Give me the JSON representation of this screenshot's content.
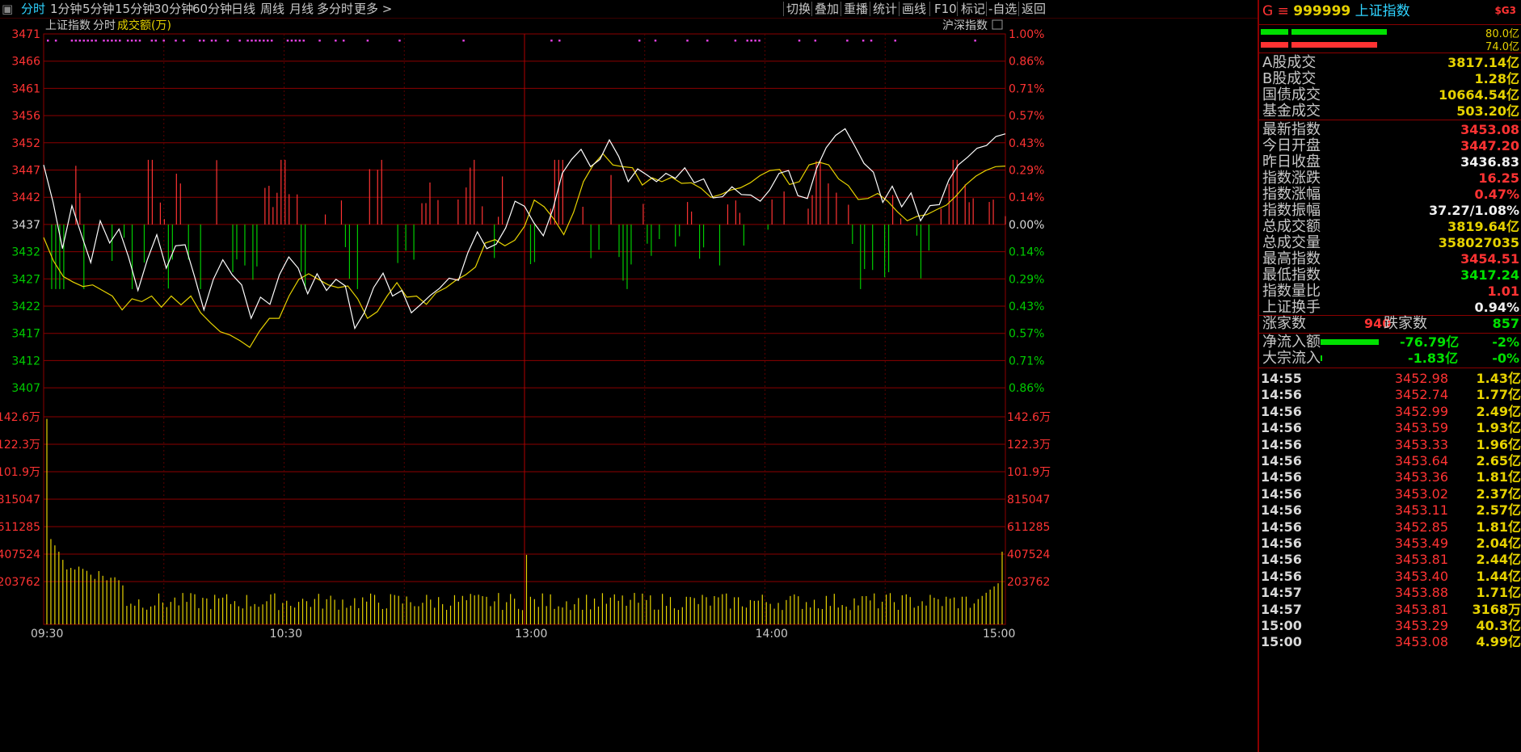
{
  "toolbar": {
    "period_tabs": [
      "分时",
      "1分钟",
      "5分钟",
      "15分钟",
      "30分钟",
      "60分钟",
      "日线",
      "周线",
      "月线",
      "多分时",
      "更多 >"
    ],
    "tools": [
      "切换",
      "叠加",
      "重播",
      "统计",
      "画线",
      "F10",
      "标记",
      "-自选",
      "返回"
    ]
  },
  "chart": {
    "legend_name": "上证指数",
    "legend_mode": "分时",
    "legend_volume": "成交额(万)",
    "overlay_label": "沪深指数",
    "colors": {
      "price": "#ffffff",
      "avg": "#e6d200",
      "up": "#ff3333",
      "down": "#00cc00",
      "grid": "#8b0000",
      "volume": "#e6d200"
    }
  },
  "chart_data": {
    "type": "line",
    "price_ticks_left": [
      "3471",
      "3466",
      "3461",
      "3456",
      "3452",
      "3447",
      "3442",
      "3437",
      "3432",
      "3427",
      "3422",
      "3417",
      "3412",
      "3407"
    ],
    "pct_ticks_right": [
      "1.00%",
      "0.86%",
      "0.71%",
      "0.57%",
      "0.43%",
      "0.29%",
      "0.14%",
      "0.00%",
      "0.14%",
      "0.29%",
      "0.43%",
      "0.57%",
      "0.71%",
      "0.86%"
    ],
    "volume_ticks": [
      "142.6万",
      "122.3万",
      "101.9万",
      "815047",
      "611285",
      "407524",
      "203762"
    ],
    "time_ticks": [
      "09:30",
      "10:30",
      "13:00",
      "14:00",
      "15:00"
    ],
    "prev_close": 3436.83,
    "ylim": [
      3407,
      3471
    ],
    "price_series": [
      3447.5,
      3440.8,
      3432.5,
      3440.2,
      3435,
      3430,
      3437.5,
      3433.5,
      3436,
      3431,
      3425,
      3430.5,
      3435,
      3429,
      3433,
      3433.2,
      3427.5,
      3421.5,
      3427,
      3430.5,
      3427.8,
      3426,
      3420,
      3423.8,
      3422.5,
      3427.8,
      3431,
      3429,
      3424.4,
      3428,
      3425,
      3427,
      3425.8,
      3418.2,
      3421,
      3425.5,
      3428.1,
      3424,
      3425,
      3421,
      3422.5,
      3424.1,
      3425.4,
      3427.2,
      3426.8,
      3431.8,
      3435.5,
      3432.5,
      3433.3,
      3436.2,
      3441,
      3440.1,
      3437.1,
      3434.8,
      3439.5,
      3446,
      3448.5,
      3450.3,
      3447.2,
      3448.5,
      3452,
      3449,
      3444.5,
      3446.8,
      3445.7,
      3444.5,
      3446,
      3445.1,
      3447,
      3444.3,
      3445,
      3441.6,
      3441.8,
      3443.6,
      3442.2,
      3442.1,
      3441,
      3443,
      3446,
      3446.5,
      3442,
      3441.5,
      3447,
      3450.6,
      3452.8,
      3454,
      3451,
      3447.8,
      3446.2,
      3440.8,
      3443.7,
      3440,
      3442.5,
      3437.5,
      3440.2,
      3440.4,
      3444.8,
      3447.5,
      3448.9,
      3450.5,
      3451,
      3452.6,
      3453.08
    ],
    "avg_series": [
      3434.5,
      3430.3,
      3427.5,
      3426.5,
      3425.7,
      3426,
      3425,
      3424,
      3421.5,
      3423.5,
      3423,
      3424,
      3422,
      3424,
      3422.4,
      3424,
      3421,
      3419.2,
      3417.6,
      3417,
      3416,
      3414.8,
      3417.7,
      3420,
      3420,
      3424,
      3427,
      3428,
      3427,
      3426,
      3425.5,
      3425.8,
      3423.5,
      3420,
      3421.2,
      3424,
      3426.4,
      3423.8,
      3424,
      3422.5,
      3424.6,
      3425.5,
      3426.8,
      3427.8,
      3429.2,
      3433.5,
      3434.1,
      3433,
      3434,
      3436.5,
      3441.2,
      3440,
      3437.8,
      3435,
      3439,
      3444.5,
      3447.5,
      3449.5,
      3447.5,
      3447.2,
      3447,
      3443.9,
      3445.2,
      3444.5,
      3445.3,
      3444.2,
      3444.3,
      3443.3,
      3441.7,
      3442.2,
      3443,
      3443.4,
      3444.3,
      3445.6,
      3446.5,
      3446.7,
      3444,
      3444.5,
      3447.5,
      3448,
      3447.5,
      3445,
      3443.8,
      3441.3,
      3441.5,
      3442.4,
      3441,
      3439.1,
      3437.5,
      3438.3,
      3438.6,
      3439.5,
      3440.3,
      3442,
      3444,
      3445.5,
      3446.5,
      3447.2,
      3447.3
    ],
    "note_time_range": [
      "09:30",
      "15:00"
    ]
  },
  "panel": {
    "market": "G",
    "code": "999999",
    "name": "上证指数",
    "tag": "$G3",
    "bar1_value": "80.0亿",
    "bar2_value": "74.0亿",
    "turnover": [
      {
        "k": "A股成交",
        "v": "3817.14亿"
      },
      {
        "k": "B股成交",
        "v": "1.28亿"
      },
      {
        "k": "国债成交",
        "v": "10664.54亿"
      },
      {
        "k": "基金成交",
        "v": "503.20亿"
      }
    ],
    "quote": [
      {
        "k": "最新指数",
        "v": "3453.08",
        "c": "red"
      },
      {
        "k": "今日开盘",
        "v": "3447.20",
        "c": "red"
      },
      {
        "k": "昨日收盘",
        "v": "3436.83",
        "c": "white"
      },
      {
        "k": "指数涨跌",
        "v": "16.25",
        "c": "red"
      },
      {
        "k": "指数涨幅",
        "v": "0.47%",
        "c": "red"
      },
      {
        "k": "指数振幅",
        "v": "37.27/1.08%",
        "c": "white"
      },
      {
        "k": "总成交额",
        "v": "3819.64亿",
        "c": "yellow"
      },
      {
        "k": "总成交量",
        "v": "358027035",
        "c": "yellow"
      },
      {
        "k": "最高指数",
        "v": "3454.51",
        "c": "red"
      },
      {
        "k": "最低指数",
        "v": "3417.24",
        "c": "green"
      },
      {
        "k": "指数量比",
        "v": "1.01",
        "c": "red"
      },
      {
        "k": "上证换手",
        "v": "0.94%",
        "c": "white"
      }
    ],
    "rise_label": "涨家数",
    "rise_value": "940",
    "fall_label": "跌家数",
    "fall_value": "857",
    "netflow_label": "净流入额",
    "netflow_value": "-76.79亿",
    "netflow_pct": "-2%",
    "netflow_fill": 0.9,
    "block_label": "大宗流入",
    "block_value": "-1.83亿",
    "block_pct": "-0%",
    "block_fill": 0.02,
    "ticks": [
      {
        "t": "14:55",
        "p": "3452.98",
        "a": "1.43亿"
      },
      {
        "t": "14:56",
        "p": "3452.74",
        "a": "1.77亿"
      },
      {
        "t": "14:56",
        "p": "3452.99",
        "a": "2.49亿"
      },
      {
        "t": "14:56",
        "p": "3453.59",
        "a": "1.93亿"
      },
      {
        "t": "14:56",
        "p": "3453.33",
        "a": "1.96亿"
      },
      {
        "t": "14:56",
        "p": "3453.64",
        "a": "2.65亿"
      },
      {
        "t": "14:56",
        "p": "3453.36",
        "a": "1.81亿"
      },
      {
        "t": "14:56",
        "p": "3453.02",
        "a": "2.37亿"
      },
      {
        "t": "14:56",
        "p": "3453.11",
        "a": "2.57亿"
      },
      {
        "t": "14:56",
        "p": "3452.85",
        "a": "1.81亿"
      },
      {
        "t": "14:56",
        "p": "3453.49",
        "a": "2.04亿"
      },
      {
        "t": "14:56",
        "p": "3453.81",
        "a": "2.44亿"
      },
      {
        "t": "14:56",
        "p": "3453.40",
        "a": "1.44亿"
      },
      {
        "t": "14:57",
        "p": "3453.88",
        "a": "1.71亿"
      },
      {
        "t": "14:57",
        "p": "3453.81",
        "a": "3168万"
      },
      {
        "t": "15:00",
        "p": "3453.29",
        "a": "40.3亿"
      },
      {
        "t": "15:00",
        "p": "3453.08",
        "a": "4.99亿"
      }
    ]
  }
}
